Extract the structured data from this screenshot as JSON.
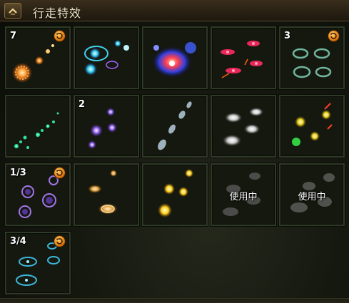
{
  "window": {
    "title": "行走特效",
    "collapse_icon": "chevron-up-icon"
  },
  "slots": [
    {
      "id": "r1c1",
      "count": "7",
      "badge": true,
      "status": ""
    },
    {
      "id": "r1c2",
      "count": "",
      "badge": false,
      "status": ""
    },
    {
      "id": "r1c3",
      "count": "",
      "badge": false,
      "status": ""
    },
    {
      "id": "r1c4",
      "count": "",
      "badge": false,
      "status": ""
    },
    {
      "id": "r1c5",
      "count": "3",
      "badge": true,
      "status": ""
    },
    {
      "id": "r2c1",
      "count": "",
      "badge": false,
      "status": ""
    },
    {
      "id": "r2c2",
      "count": "2",
      "badge": false,
      "status": ""
    },
    {
      "id": "r2c3",
      "count": "",
      "badge": false,
      "status": ""
    },
    {
      "id": "r2c4",
      "count": "",
      "badge": false,
      "status": ""
    },
    {
      "id": "r2c5",
      "count": "",
      "badge": false,
      "status": ""
    },
    {
      "id": "r3c1",
      "count": "1/3",
      "badge": true,
      "status": ""
    },
    {
      "id": "r3c2",
      "count": "",
      "badge": false,
      "status": ""
    },
    {
      "id": "r3c3",
      "count": "",
      "badge": false,
      "status": ""
    },
    {
      "id": "r3c4",
      "count": "",
      "badge": false,
      "status": "使用中"
    },
    {
      "id": "r3c5",
      "count": "",
      "badge": false,
      "status": "使用中"
    },
    {
      "id": "r4c1",
      "count": "3/4",
      "badge": true,
      "status": ""
    }
  ],
  "colors": {
    "slot_border": "#2f3a26",
    "title_bar": "#2a2114",
    "badge": "#e07a10"
  }
}
